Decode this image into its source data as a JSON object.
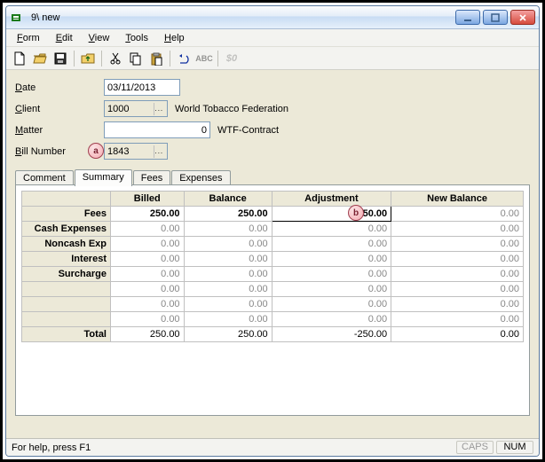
{
  "window": {
    "title": "9\\ new"
  },
  "menu": {
    "form": "Form",
    "edit": "Edit",
    "view": "View",
    "tools": "Tools",
    "help": "Help"
  },
  "form": {
    "date_label": "Date",
    "date_u": "D",
    "date_rest": "ate",
    "date_value": "03/11/2013",
    "client_label_u": "C",
    "client_label_rest": "lient",
    "client_value": "1000",
    "client_name": "World  Tobacco Federation",
    "matter_label_u": "M",
    "matter_label_rest": "atter",
    "matter_value": "0",
    "matter_name": "WTF-Contract",
    "bill_label_u": "B",
    "bill_label_rest": "ill Number",
    "bill_value": "1843",
    "lookup": "..."
  },
  "tabs": {
    "comment": "Comment",
    "summary": "Summary",
    "fees": "Fees",
    "expenses": "Expenses"
  },
  "grid": {
    "headers": {
      "billed": "Billed",
      "balance": "Balance",
      "adjustment": "Adjustment",
      "newbalance": "New Balance"
    },
    "rows": [
      {
        "name": "Fees",
        "billed": "250.00",
        "balance": "250.00",
        "adj": "-250.00",
        "new": "0.00",
        "strong": true,
        "focus": true
      },
      {
        "name": "Cash Expenses",
        "billed": "0.00",
        "balance": "0.00",
        "adj": "0.00",
        "new": "0.00"
      },
      {
        "name": "Noncash Exp",
        "billed": "0.00",
        "balance": "0.00",
        "adj": "0.00",
        "new": "0.00"
      },
      {
        "name": "Interest",
        "billed": "0.00",
        "balance": "0.00",
        "adj": "0.00",
        "new": "0.00"
      },
      {
        "name": "Surcharge",
        "billed": "0.00",
        "balance": "0.00",
        "adj": "0.00",
        "new": "0.00"
      },
      {
        "name": "",
        "billed": "0.00",
        "balance": "0.00",
        "adj": "0.00",
        "new": "0.00"
      },
      {
        "name": "",
        "billed": "0.00",
        "balance": "0.00",
        "adj": "0.00",
        "new": "0.00"
      },
      {
        "name": "",
        "billed": "0.00",
        "balance": "0.00",
        "adj": "0.00",
        "new": "0.00"
      }
    ],
    "total": {
      "name": "Total",
      "billed": "250.00",
      "balance": "250.00",
      "adj": "-250.00",
      "new": "0.00"
    }
  },
  "callouts": {
    "a": "a",
    "b": "b"
  },
  "status": {
    "help": "For help, press F1",
    "caps": "CAPS",
    "num": "NUM"
  },
  "toolbar_dollar": "$0"
}
